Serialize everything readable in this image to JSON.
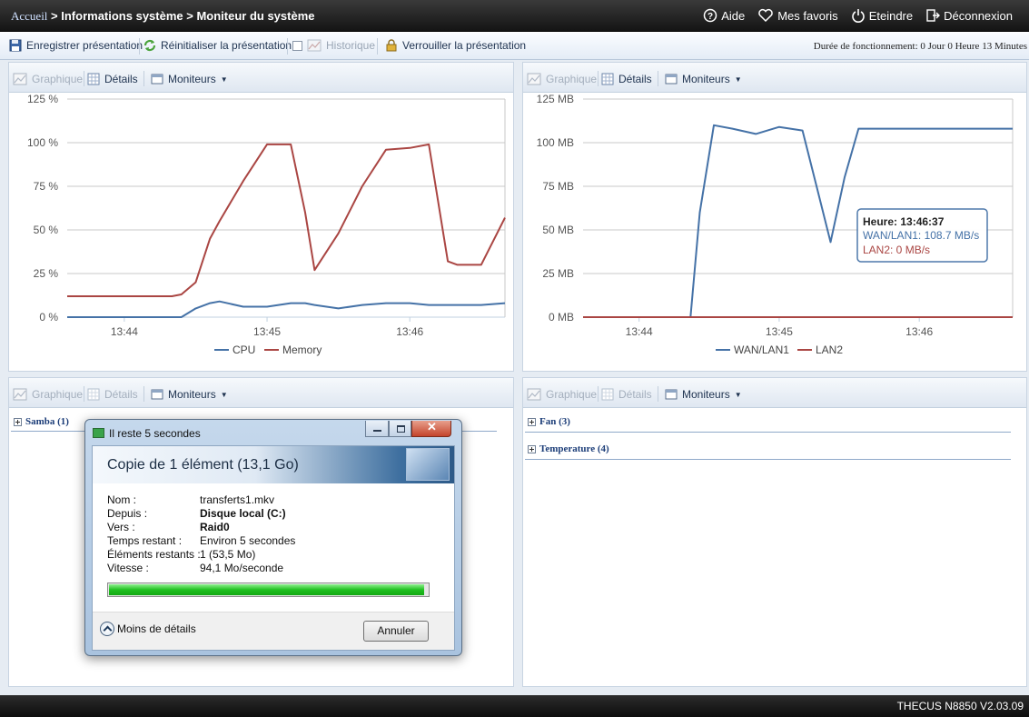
{
  "breadcrumb": {
    "home": "Accueil",
    "sep1": " > ",
    "section": "Informations système",
    "sep2": " > ",
    "page": "Moniteur du système"
  },
  "topnav": {
    "help": "Aide",
    "favorites": "Mes favoris",
    "shutdown": "Eteindre",
    "logout": "Déconnexion"
  },
  "toolbar": {
    "save": "Enregistrer présentation",
    "reset": "Réinitialiser la présentation",
    "history": "Historique",
    "lock": "Verrouiller la présentation",
    "uptime": "Durée de fonctionnement:  0 Jour 0 Heure 13 Minutes"
  },
  "panel_tools": {
    "graph": "Graphique",
    "details": "Détails",
    "monitors": "Moniteurs"
  },
  "chart_data": [
    {
      "type": "line",
      "x": [
        "13:43:36",
        "13:43:40",
        "13:43:50",
        "13:44:00",
        "13:44:10",
        "13:44:20",
        "13:44:24",
        "13:44:30",
        "13:44:36",
        "13:44:40",
        "13:44:50",
        "13:45:00",
        "13:45:10",
        "13:45:16",
        "13:45:20",
        "13:45:30",
        "13:45:40",
        "13:45:50",
        "13:46:00",
        "13:46:08",
        "13:46:16",
        "13:46:20",
        "13:46:30",
        "13:46:40"
      ],
      "x_ticks": [
        "13:44",
        "13:45",
        "13:46"
      ],
      "series": [
        {
          "name": "CPU",
          "color": "#4572a7",
          "values": [
            0,
            0,
            0,
            0,
            0,
            0,
            0,
            5,
            8,
            9,
            6,
            6,
            8,
            8,
            7,
            5,
            7,
            8,
            8,
            7,
            7,
            7,
            7,
            8
          ]
        },
        {
          "name": "Memory",
          "color": "#aa4643",
          "values": [
            12,
            12,
            12,
            12,
            12,
            12,
            13,
            20,
            45,
            55,
            78,
            99,
            99,
            60,
            27,
            48,
            75,
            96,
            97,
            99,
            32,
            30,
            30,
            57
          ]
        }
      ],
      "ylim": [
        0,
        125
      ],
      "y_ticks": [
        "0 %",
        "25 %",
        "50 %",
        "75 %",
        "100 %",
        "125 %"
      ],
      "legend": "bottom"
    },
    {
      "type": "line",
      "x": [
        "13:43:36",
        "13:43:50",
        "13:44:00",
        "13:44:10",
        "13:44:18",
        "13:44:22",
        "13:44:26",
        "13:44:32",
        "13:44:40",
        "13:44:50",
        "13:45:00",
        "13:45:10",
        "13:45:16",
        "13:45:22",
        "13:45:28",
        "13:45:34",
        "13:45:40",
        "13:45:50",
        "13:46:00",
        "13:46:10",
        "13:46:20",
        "13:46:30",
        "13:46:40"
      ],
      "x_ticks": [
        "13:44",
        "13:45",
        "13:46"
      ],
      "series": [
        {
          "name": "WAN/LAN1",
          "color": "#4572a7",
          "values": [
            0,
            0,
            0,
            0,
            0,
            0,
            60,
            110,
            108,
            105,
            109,
            107,
            75,
            43,
            80,
            108,
            108,
            108,
            108,
            108,
            108,
            108,
            108
          ]
        },
        {
          "name": "LAN2",
          "color": "#aa4643",
          "values": [
            0,
            0,
            0,
            0,
            0,
            0,
            0,
            0,
            0,
            0,
            0,
            0,
            0,
            0,
            0,
            0,
            0,
            0,
            0,
            0,
            0,
            0,
            0
          ]
        }
      ],
      "ylim": [
        0,
        125
      ],
      "y_ticks": [
        "0 MB",
        "25 MB",
        "50 MB",
        "75 MB",
        "100 MB",
        "125 MB"
      ],
      "legend": "bottom",
      "tooltip": {
        "title": "Heure: 13:46:37",
        "line1": "WAN/LAN1: 108.7 MB/s",
        "line2": "LAN2: 0 MB/s"
      }
    }
  ],
  "groups": {
    "samba": "Samba (1)",
    "fan": "Fan (3)",
    "temperature": "Temperature (4)"
  },
  "dialog": {
    "title": "Il reste 5 secondes",
    "heading": "Copie de 1 élément (13,1 Go)",
    "rows": [
      {
        "label": "Nom :",
        "value": "transferts1.mkv"
      },
      {
        "label": "Depuis :",
        "value": "Disque local (C:)"
      },
      {
        "label": "Vers :",
        "value": "Raid0"
      },
      {
        "label": "Temps restant :",
        "value": "Environ 5 secondes"
      },
      {
        "label": "Éléments restants :",
        "value": "1 (53,5 Mo)"
      },
      {
        "label": "Vitesse :",
        "value": "94,1 Mo/seconde"
      }
    ],
    "progress": 0.99,
    "less_details": "Moins de détails",
    "cancel": "Annuler"
  },
  "footer": {
    "brand": "THECUS N8850 V2.03.09"
  }
}
